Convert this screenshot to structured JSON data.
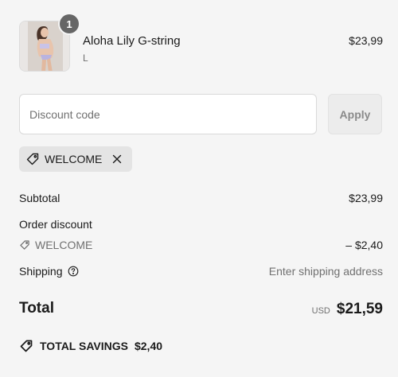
{
  "product": {
    "name": "Aloha Lily G-string",
    "variant": "L",
    "price": "$23,99",
    "quantity": "1",
    "image_icon": "product-photo"
  },
  "discount": {
    "placeholder": "Discount code",
    "value": "",
    "apply_label": "Apply",
    "applied_code": "WELCOME"
  },
  "summary": {
    "subtotal_label": "Subtotal",
    "subtotal_value": "$23,99",
    "order_discount_label": "Order discount",
    "discount_code": "WELCOME",
    "discount_value": "– $2,40",
    "shipping_label": "Shipping",
    "shipping_value": "Enter shipping address",
    "total_label": "Total",
    "total_currency": "USD",
    "total_value": "$21,59",
    "savings_label": "TOTAL SAVINGS",
    "savings_value": "$2,40"
  },
  "colors": {
    "background": "#f5f5f5",
    "muted_text": "#707070",
    "badge": "#666666",
    "chip_bg": "#e4e4e4"
  }
}
